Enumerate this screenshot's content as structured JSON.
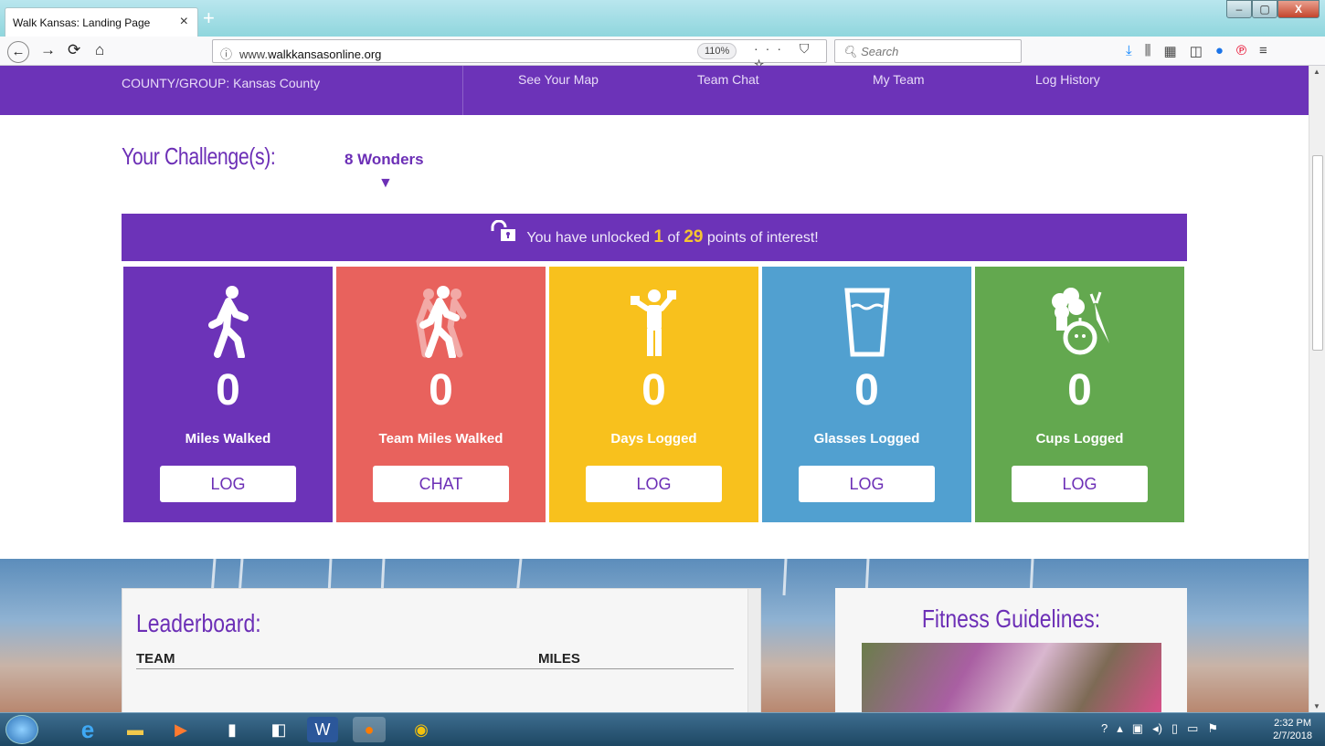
{
  "browser": {
    "tab_title": "Walk Kansas: Landing Page",
    "tab_close": "×",
    "new_tab": "+",
    "url_info_icon": "ⓘ",
    "url_prefix": "www.",
    "url_domain": "walkkansasonline.org",
    "zoom": "110%",
    "page_actions": "··· ⛉ ☆",
    "search_placeholder": "Search",
    "window_controls": [
      "–",
      "▢",
      "X"
    ]
  },
  "nav": {
    "county_label": "COUNTY/GROUP:",
    "county_value": "Kansas County",
    "links": [
      "See Your Map",
      "Team Chat",
      "My Team",
      "Log History"
    ]
  },
  "challenge": {
    "title": "Your Challenge(s):",
    "name": "8 Wonders",
    "arrow": "▼"
  },
  "unlock": {
    "prefix": "You have unlocked",
    "unlocked": "1",
    "of": "of",
    "total": "29",
    "suffix": "points of interest!"
  },
  "cards": [
    {
      "value": "0",
      "label": "Miles Walked",
      "button": "LOG",
      "color": "#6c33b8",
      "btn_color": "#6c2fb6",
      "icon": "walker-icon"
    },
    {
      "value": "0",
      "label": "Team Miles Walked",
      "button": "CHAT",
      "color": "#e8625d",
      "btn_color": "#6c2fb6",
      "icon": "team-walkers-icon"
    },
    {
      "value": "0",
      "label": "Days Logged",
      "button": "LOG",
      "color": "#f8c11d",
      "btn_color": "#6c2fb6",
      "icon": "weightlifter-icon"
    },
    {
      "value": "0",
      "label": "Glasses Logged",
      "button": "LOG",
      "color": "#51a0d0",
      "btn_color": "#6c2fb6",
      "icon": "water-glass-icon"
    },
    {
      "value": "0",
      "label": "Cups Logged",
      "button": "LOG",
      "color": "#63a84f",
      "btn_color": "#6c2fb6",
      "icon": "produce-icon"
    }
  ],
  "leaderboard": {
    "title": "Leaderboard:",
    "col_team": "TEAM",
    "col_miles": "MILES"
  },
  "fitness": {
    "title": "Fitness Guidelines:"
  },
  "taskbar": {
    "time": "2:32 PM",
    "date": "2/7/2018"
  }
}
